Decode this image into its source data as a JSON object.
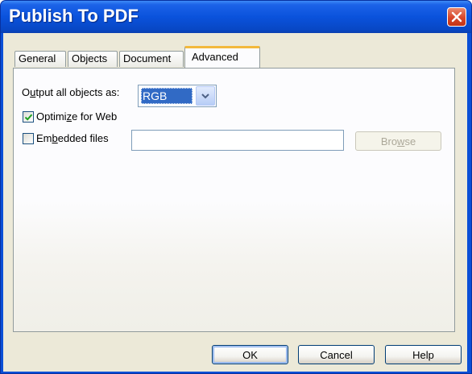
{
  "window": {
    "title": "Publish To PDF"
  },
  "tabs": [
    {
      "label": "General",
      "active": false
    },
    {
      "label": "Objects",
      "active": false
    },
    {
      "label": "Document",
      "active": false
    },
    {
      "label": "Advanced",
      "active": true
    }
  ],
  "advanced": {
    "output_label_pre": "O",
    "output_label_ul": "u",
    "output_label_post": "tput all objects as:",
    "output_value": "RGB",
    "optimize_checked": true,
    "optimize_label_pre": "Optimi",
    "optimize_label_ul": "z",
    "optimize_label_post": "e for Web",
    "embedded_checked": false,
    "embedded_label_pre": "Em",
    "embedded_label_ul": "b",
    "embedded_label_post": "edded files",
    "embedded_path": "",
    "browse_label_pre": "Bro",
    "browse_label_ul": "w",
    "browse_label_post": "se"
  },
  "buttons": {
    "ok": "OK",
    "cancel": "Cancel",
    "help": "Help"
  },
  "colors": {
    "titlebar": "#0a52dc",
    "dialog_bg": "#ece9d8",
    "selection": "#316ac5",
    "active_tab_accent": "#f3b93c",
    "close_button": "#d8462a"
  }
}
